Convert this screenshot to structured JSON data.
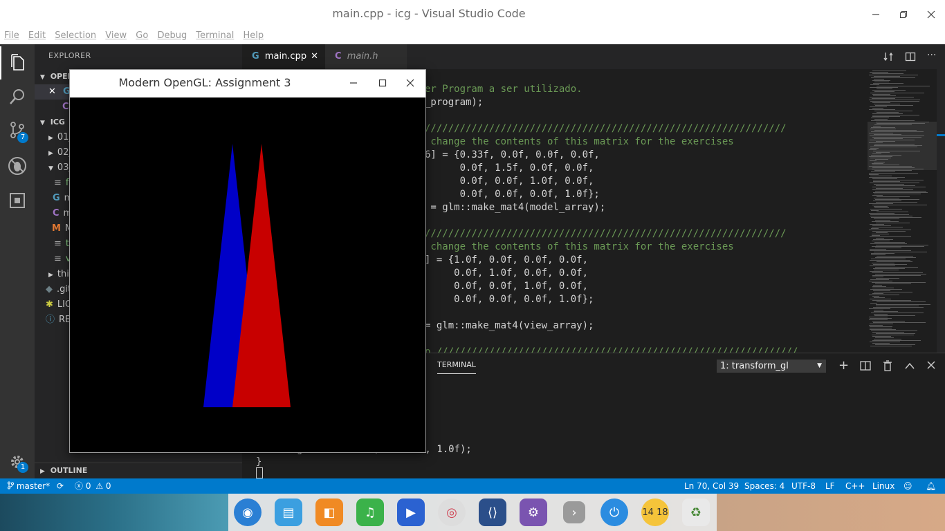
{
  "window": {
    "title": "main.cpp - icg - Visual Studio Code"
  },
  "menu": [
    "File",
    "Edit",
    "Selection",
    "View",
    "Go",
    "Debug",
    "Terminal",
    "Help"
  ],
  "activity": {
    "scm_badge": "7",
    "settings_badge": "1"
  },
  "sidebar": {
    "title": "EXPLORER",
    "open_editors_label": "OPEN",
    "icg_label": "ICG",
    "rows": [
      "01_",
      "02_",
      "03_",
      "fr",
      "m",
      "m",
      "M",
      "tr",
      "ve",
      "thir",
      ".git",
      "LIC",
      "RE"
    ],
    "outline": "OUTLINE"
  },
  "tabs": [
    {
      "label": "main.cpp",
      "active": true
    },
    {
      "label": "main.h",
      "active": false
    }
  ],
  "code": [
    "er Program a ser utilizado.",
    "_program);",
    "",
    "//////////////////////////////////////////////////////////////",
    " change the contents of this matrix for the exercises",
    "6] = {0.33f, 0.0f, 0.0f, 0.0f,",
    "      0.0f, 1.5f, 0.0f, 0.0f,",
    "      0.0f, 0.0f, 1.0f, 0.0f,",
    "      0.0f, 0.0f, 0.0f, 1.0f};",
    " = glm::make_mat4(model_array);",
    "",
    "//////////////////////////////////////////////////////////////",
    " change the contents of this matrix for the exercises",
    "] = {1.0f, 0.0f, 0.0f, 0.0f,",
    "     0.0f, 1.0f, 0.0f, 0.0f,",
    "     0.0f, 0.0f, 1.0f, 0.0f,",
    "     0.0f, 0.0f, 0.0f, 1.0f};",
    "",
    "= glm::make_mat4(view_array);",
    "",
    "p //////////////////////////////////////////////////////////////"
  ],
  "panel": {
    "tab": "TERMINAL",
    "terminal_select": "1: transform_gl",
    "line1": "    fragColor = vec4(outColor, 1.0f);",
    "line2": "}"
  },
  "status": {
    "branch": "master*",
    "errors": "0",
    "warnings": "0",
    "position": "Ln 70, Col 39",
    "spaces": "Spaces: 4",
    "encoding": "UTF-8",
    "eol": "LF",
    "language": "C++",
    "os": "Linux"
  },
  "glwindow": {
    "title": "Modern OpenGL: Assignment 3"
  },
  "triangles": [
    {
      "name": "blue",
      "color": "#0000c8"
    },
    {
      "name": "red",
      "color": "#c80000"
    }
  ],
  "dock_clock": "14 18"
}
